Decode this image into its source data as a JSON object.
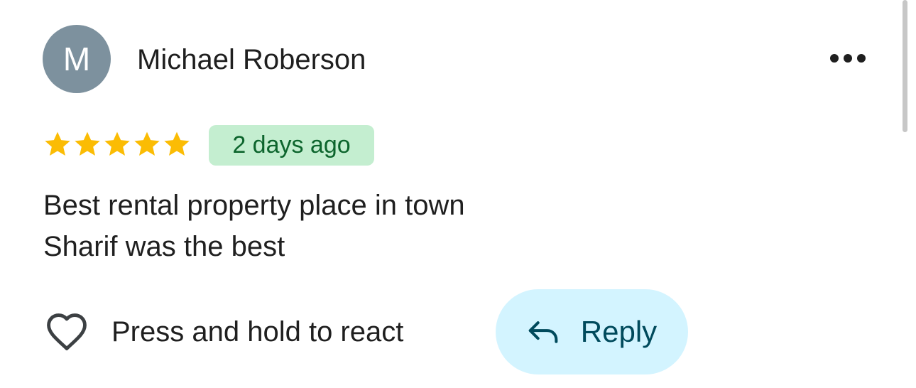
{
  "review": {
    "author": {
      "name": "Michael Roberson",
      "avatar_initial": "M",
      "avatar_color": "#7d919e"
    },
    "rating": 5,
    "rating_max": 5,
    "time_label": "2 days ago",
    "lines": [
      "Best rental property place in town",
      "Sharif was the best"
    ]
  },
  "actions": {
    "more_icon": "more-horizontal-icon",
    "react_icon": "heart-outline-icon",
    "react_label": "Press and hold to react",
    "reply_icon": "reply-arrow-icon",
    "reply_label": "Reply"
  },
  "colors": {
    "star": "#fbbc04",
    "badge_bg": "#c4eed0",
    "badge_text": "#0d652d",
    "reply_bg": "#d3f4ff",
    "reply_text": "#004a5c",
    "text": "#1f1f1f"
  }
}
